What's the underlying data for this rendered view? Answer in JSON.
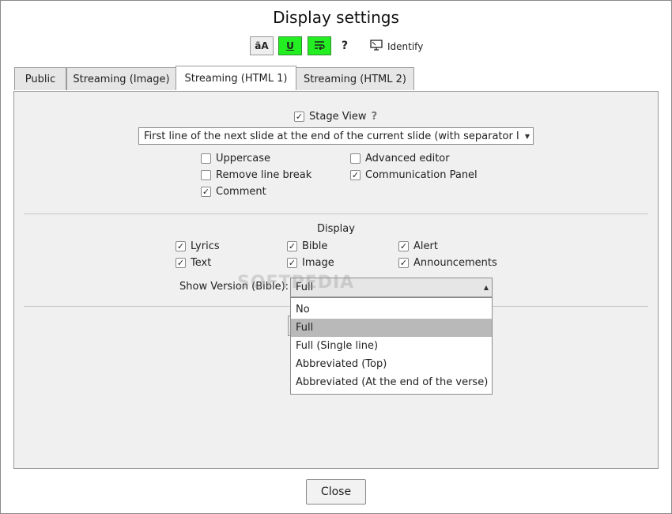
{
  "window": {
    "title": "Display settings"
  },
  "toolbar": {
    "font_btn": "ãA",
    "underline_btn": "U",
    "wrap_btn": "≡",
    "help": "?",
    "identify": "Identify"
  },
  "tabs": [
    {
      "label": "Public",
      "active": false
    },
    {
      "label": "Streaming (Image)",
      "active": false
    },
    {
      "label": "Streaming (HTML 1)",
      "active": true
    },
    {
      "label": "Streaming (HTML 2)",
      "active": false
    }
  ],
  "stage": {
    "stage_view_label": "Stage View",
    "stage_view_checked": true,
    "help": "?",
    "mode_select_value": "First line of the next slide at the end of the current slide (with separator l..."
  },
  "options": {
    "uppercase": {
      "label": "Uppercase",
      "checked": false
    },
    "remove_line_break": {
      "label": "Remove line break",
      "checked": false
    },
    "comment": {
      "label": "Comment",
      "checked": true
    },
    "advanced_editor": {
      "label": "Advanced editor",
      "checked": false
    },
    "communication_panel": {
      "label": "Communication Panel",
      "checked": true
    }
  },
  "display": {
    "title": "Display",
    "lyrics": {
      "label": "Lyrics",
      "checked": true
    },
    "text": {
      "label": "Text",
      "checked": true
    },
    "bible": {
      "label": "Bible",
      "checked": true
    },
    "image": {
      "label": "Image",
      "checked": true
    },
    "alert": {
      "label": "Alert",
      "checked": true
    },
    "announcements": {
      "label": "Announcements",
      "checked": true
    },
    "show_version_label": "Show Version (Bible):",
    "show_version_value": "Full",
    "show_version_options": [
      "No",
      "Full",
      "Full (Single line)",
      "Abbreviated (Top)",
      "Abbreviated (At the end of the verse)"
    ],
    "show_version_selected_index": 1
  },
  "footer": {
    "close_label": "Close"
  },
  "watermark": "SOFTPEDIA"
}
